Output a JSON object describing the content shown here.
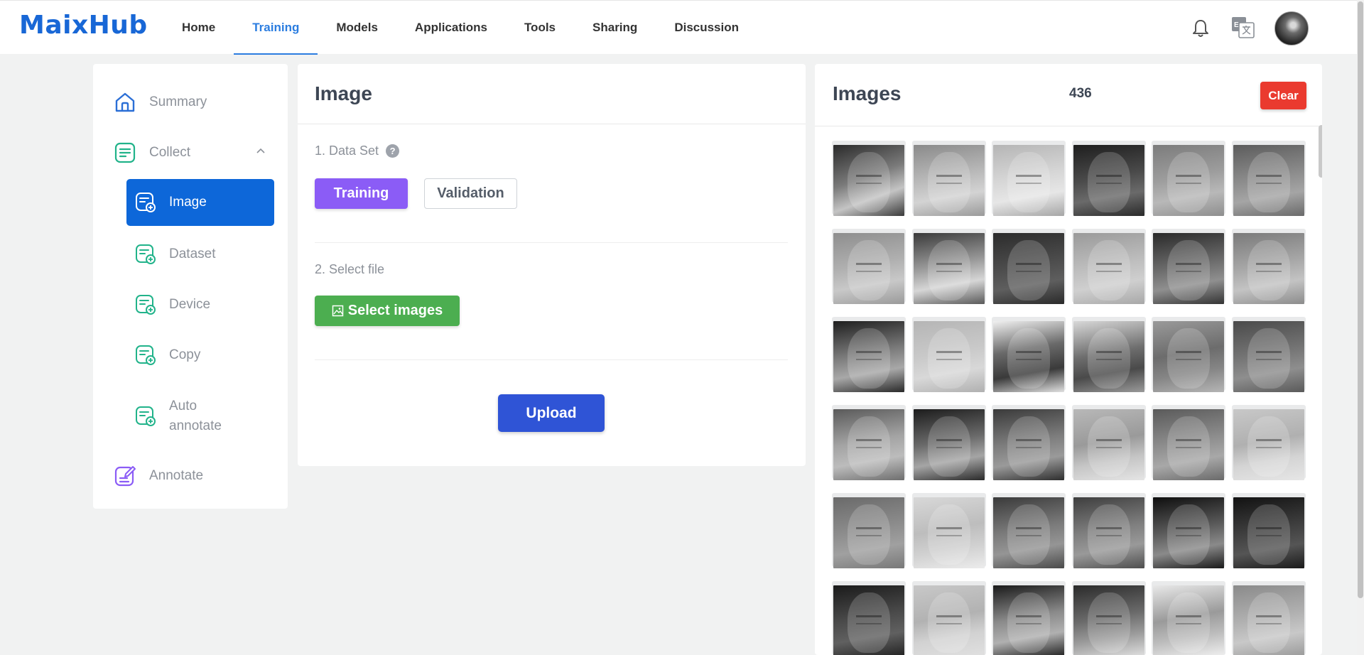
{
  "brand": {
    "logo": "MaixHub"
  },
  "nav": {
    "items": [
      {
        "label": "Home"
      },
      {
        "label": "Training"
      },
      {
        "label": "Models"
      },
      {
        "label": "Applications"
      },
      {
        "label": "Tools"
      },
      {
        "label": "Sharing"
      },
      {
        "label": "Discussion"
      }
    ],
    "active": "Training",
    "lang_badge": "En"
  },
  "sidebar": {
    "summary": "Summary",
    "collect": "Collect",
    "collect_expanded": true,
    "sub_items": [
      "Image",
      "Dataset",
      "Device",
      "Copy",
      "Auto annotate"
    ],
    "auto_line1": "Auto",
    "auto_line2": "annotate",
    "active_item": "Image",
    "annotate": "Annotate"
  },
  "upload_panel": {
    "title": "Image",
    "step1_label": "1. Data Set",
    "help_glyph": "?",
    "training_button": "Training",
    "validation_button": "Validation",
    "selected_dataset": "Training",
    "step2_label": "2. Select file",
    "select_button": "Select images",
    "upload_button": "Upload"
  },
  "images_panel": {
    "title": "Images",
    "count": "436",
    "clear_button": "Clear"
  },
  "colors": {
    "brand": "#1867d6",
    "active_sidebar": "#0d67d9",
    "training_button": "#8b5cf6",
    "select_button": "#4cae50",
    "upload_button": "#2f54d6",
    "clear_button": "#ea3a2f",
    "sidebar_icon_green": "#21b38a",
    "sidebar_icon_blue": "#2b6fd6",
    "sidebar_icon_purple": "#8b5cf6"
  }
}
